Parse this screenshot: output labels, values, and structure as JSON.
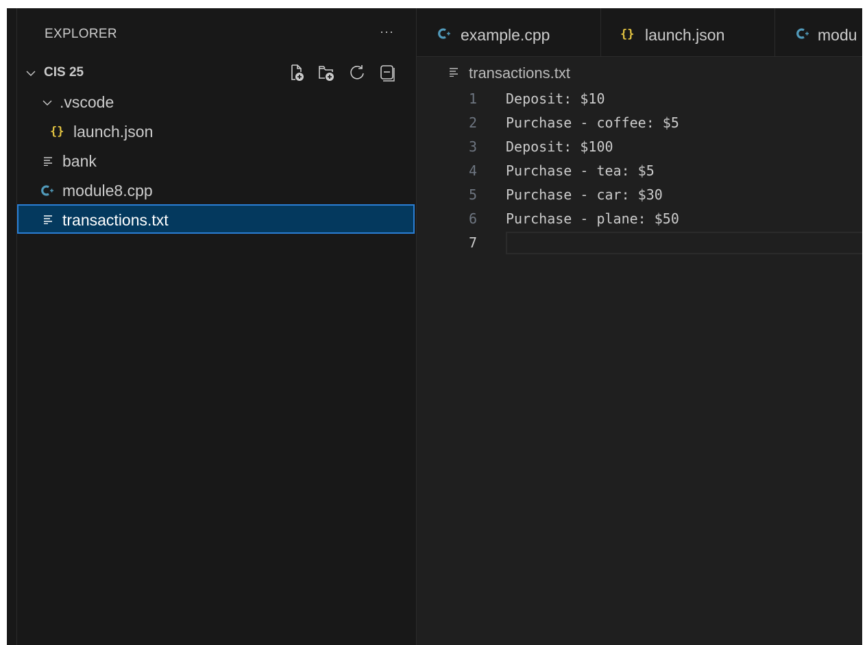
{
  "explorer": {
    "title": "EXPLORER",
    "more": "···",
    "folder": "CIS 25",
    "items": [
      {
        "label": ".vscode",
        "kind": "folder",
        "indent": 1
      },
      {
        "label": "launch.json",
        "kind": "json",
        "indent": 2
      },
      {
        "label": "bank",
        "kind": "text",
        "indent": 1
      },
      {
        "label": "module8.cpp",
        "kind": "cpp",
        "indent": 1
      },
      {
        "label": "transactions.txt",
        "kind": "text",
        "indent": 1,
        "selected": true
      }
    ]
  },
  "icons": {
    "json": "{}",
    "cpp": "C++ icon"
  },
  "tabs": [
    {
      "label": "example.cpp",
      "kind": "cpp"
    },
    {
      "label": "launch.json",
      "kind": "json"
    },
    {
      "label": "modu",
      "kind": "cpp"
    }
  ],
  "breadcrumb": "transactions.txt",
  "editor": {
    "lines": [
      {
        "n": "1",
        "text": "Deposit: $10"
      },
      {
        "n": "2",
        "text": "Purchase - coffee: $5"
      },
      {
        "n": "3",
        "text": "Deposit: $100"
      },
      {
        "n": "4",
        "text": "Purchase - tea: $5"
      },
      {
        "n": "5",
        "text": "Purchase - car: $30"
      },
      {
        "n": "6",
        "text": "Purchase - plane: $50"
      },
      {
        "n": "7",
        "text": "",
        "current": true
      }
    ]
  },
  "colors": {
    "selection_bg": "#04395e",
    "selection_border": "#2a7fd6",
    "json_icon": "#e2c341",
    "cpp_icon": "#519aba"
  }
}
